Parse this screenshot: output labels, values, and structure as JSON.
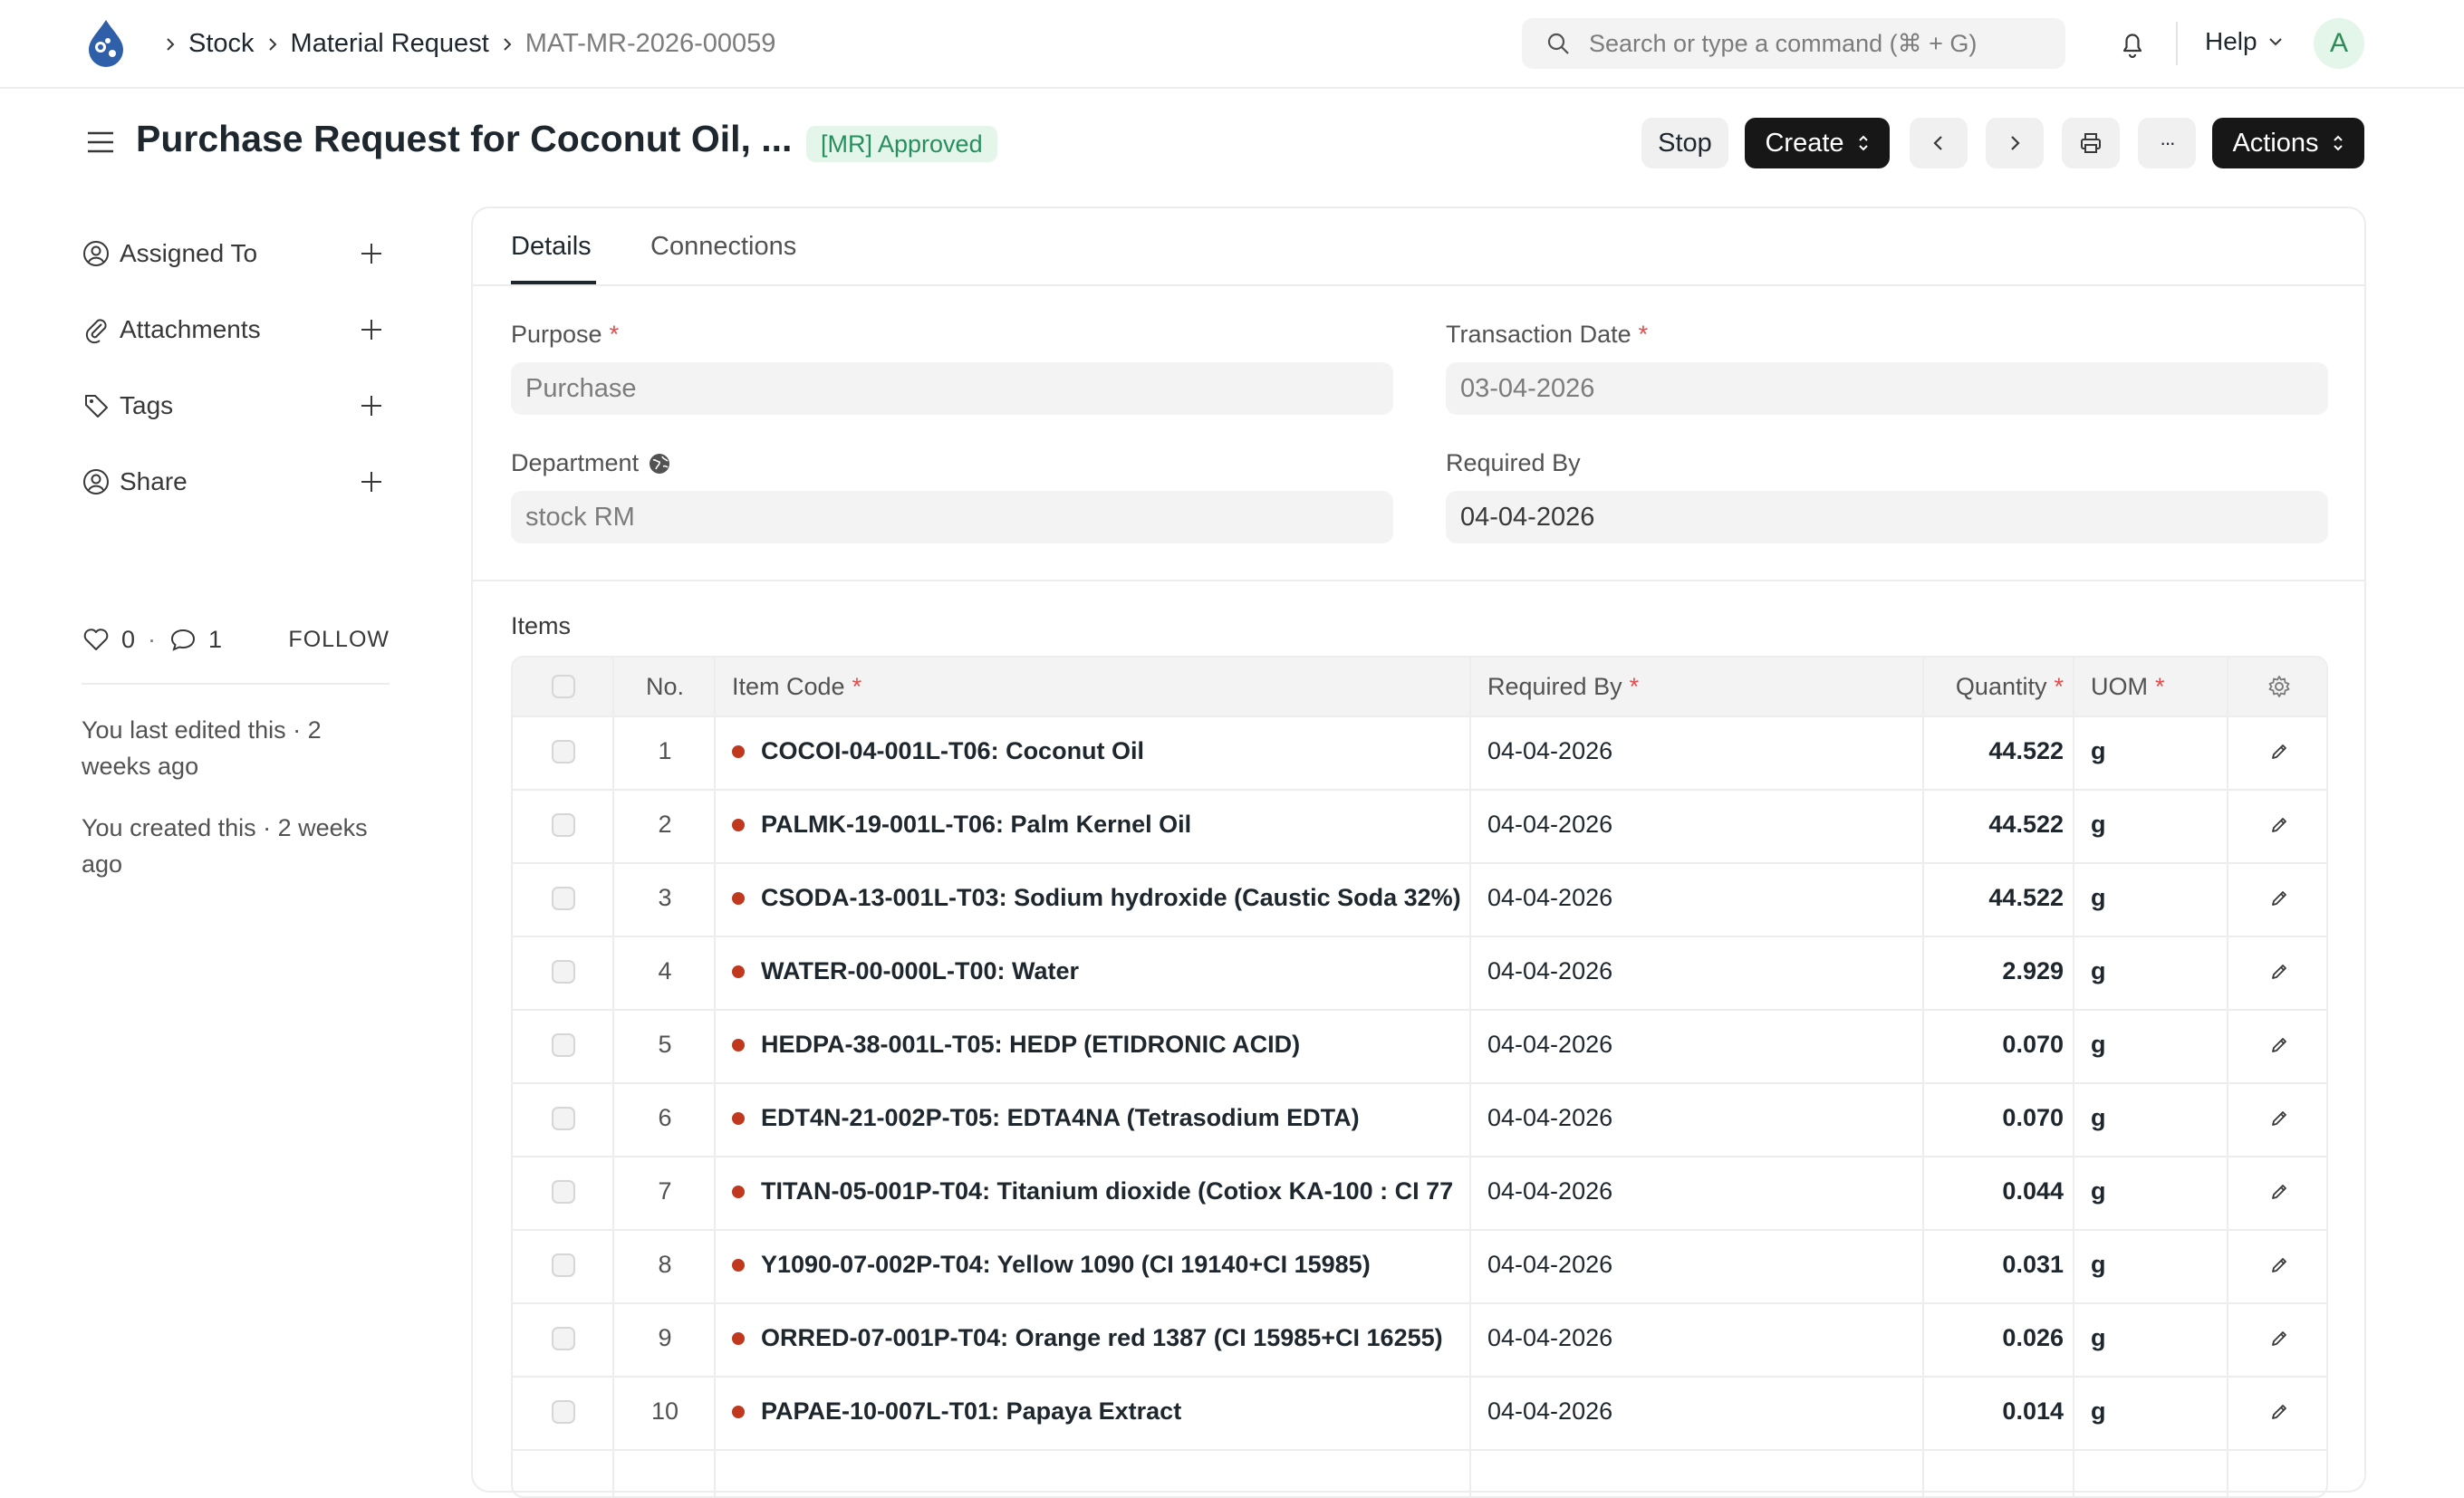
{
  "breadcrumbs": [
    {
      "label": "Stock"
    },
    {
      "label": "Material Request"
    },
    {
      "label": "MAT-MR-2026-00059"
    }
  ],
  "search": {
    "placeholder": "Search or type a command (⌘ + G)"
  },
  "navbar": {
    "help_label": "Help",
    "avatar_initial": "A"
  },
  "page": {
    "title": "Purchase Request for Coconut Oil, ...",
    "status": "[MR] Approved",
    "buttons": {
      "stop": "Stop",
      "create": "Create",
      "more": "···",
      "actions": "Actions"
    }
  },
  "sidebar": {
    "items": [
      {
        "label": "Assigned To",
        "icon": "user-assign-icon"
      },
      {
        "label": "Attachments",
        "icon": "paperclip-icon"
      },
      {
        "label": "Tags",
        "icon": "tag-icon"
      },
      {
        "label": "Share",
        "icon": "share-user-icon"
      }
    ],
    "likes": "0",
    "comments": "1",
    "follow": "FOLLOW",
    "last_edited": "You last edited this · 2 weeks ago",
    "created": "You created this · 2 weeks ago"
  },
  "tabs": [
    {
      "label": "Details"
    },
    {
      "label": "Connections"
    }
  ],
  "form": {
    "purpose": {
      "label": "Purpose",
      "value": "Purchase"
    },
    "transaction_date": {
      "label": "Transaction Date",
      "value": "03-04-2026"
    },
    "department": {
      "label": "Department",
      "value": "stock RM"
    },
    "required_by": {
      "label": "Required By",
      "value": "04-04-2026"
    }
  },
  "items_table": {
    "label": "Items",
    "headers": {
      "no": "No.",
      "item_code": "Item Code",
      "required_by": "Required By",
      "quantity": "Quantity",
      "uom": "UOM"
    },
    "rows": [
      {
        "no": "1",
        "item_code": "COCOI-04-001L-T06: Coconut Oil",
        "required_by": "04-04-2026",
        "quantity": "44.522",
        "uom": "g"
      },
      {
        "no": "2",
        "item_code": "PALMK-19-001L-T06: Palm Kernel Oil",
        "required_by": "04-04-2026",
        "quantity": "44.522",
        "uom": "g"
      },
      {
        "no": "3",
        "item_code": "CSODA-13-001L-T03: Sodium hydroxide (Caustic Soda 32%)",
        "required_by": "04-04-2026",
        "quantity": "44.522",
        "uom": "g"
      },
      {
        "no": "4",
        "item_code": "WATER-00-000L-T00: Water",
        "required_by": "04-04-2026",
        "quantity": "2.929",
        "uom": "g"
      },
      {
        "no": "5",
        "item_code": "HEDPA-38-001L-T05: HEDP (ETIDRONIC ACID)",
        "required_by": "04-04-2026",
        "quantity": "0.070",
        "uom": "g"
      },
      {
        "no": "6",
        "item_code": "EDT4N-21-002P-T05: EDTA4NA (Tetrasodium EDTA)",
        "required_by": "04-04-2026",
        "quantity": "0.070",
        "uom": "g"
      },
      {
        "no": "7",
        "item_code": "TITAN-05-001P-T04: Titanium dioxide (Cotiox KA-100 : CI 77",
        "required_by": "04-04-2026",
        "quantity": "0.044",
        "uom": "g"
      },
      {
        "no": "8",
        "item_code": "Y1090-07-002P-T04: Yellow 1090 (CI 19140+CI 15985)",
        "required_by": "04-04-2026",
        "quantity": "0.031",
        "uom": "g"
      },
      {
        "no": "9",
        "item_code": "ORRED-07-001P-T04: Orange red 1387 (CI 15985+CI 16255)",
        "required_by": "04-04-2026",
        "quantity": "0.026",
        "uom": "g"
      },
      {
        "no": "10",
        "item_code": "PAPAE-10-007L-T01: Papaya Extract",
        "required_by": "04-04-2026",
        "quantity": "0.014",
        "uom": "g"
      }
    ]
  },
  "colors": {
    "status_green": "#278f5e",
    "required_red": "#e24c4c",
    "item_dot": "#c0391f",
    "dark_button": "#171717"
  }
}
